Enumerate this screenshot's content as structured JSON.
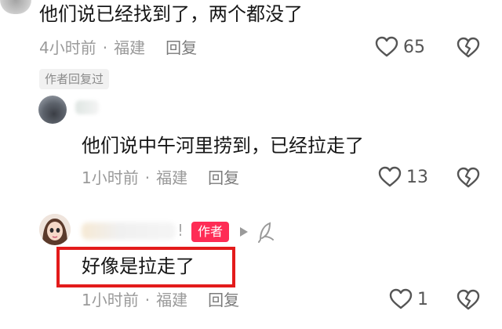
{
  "comment1": {
    "text": "他们说已经找到了，两个都没了",
    "time": "4小时前",
    "location": "福建",
    "reply_label": "回复",
    "likes": "65",
    "author_replied_tag": "作者回复过"
  },
  "comment2": {
    "text": "他们说中午河里捞到，已经拉走了",
    "time": "1小时前",
    "location": "福建",
    "reply_label": "回复",
    "likes": "13"
  },
  "comment3": {
    "name_suffix": "!",
    "author_badge": "作者",
    "text": "好像是拉走了",
    "time": "1小时前",
    "location": "福建",
    "reply_label": "回复",
    "likes": "1"
  },
  "colors": {
    "author_badge": "#fe2c55",
    "highlight_box": "#e31b1b",
    "meta_text": "#9a9a9a"
  },
  "icons": [
    "heart-outline-icon",
    "broken-heart-icon",
    "play-arrow-icon",
    "feather-icon"
  ]
}
